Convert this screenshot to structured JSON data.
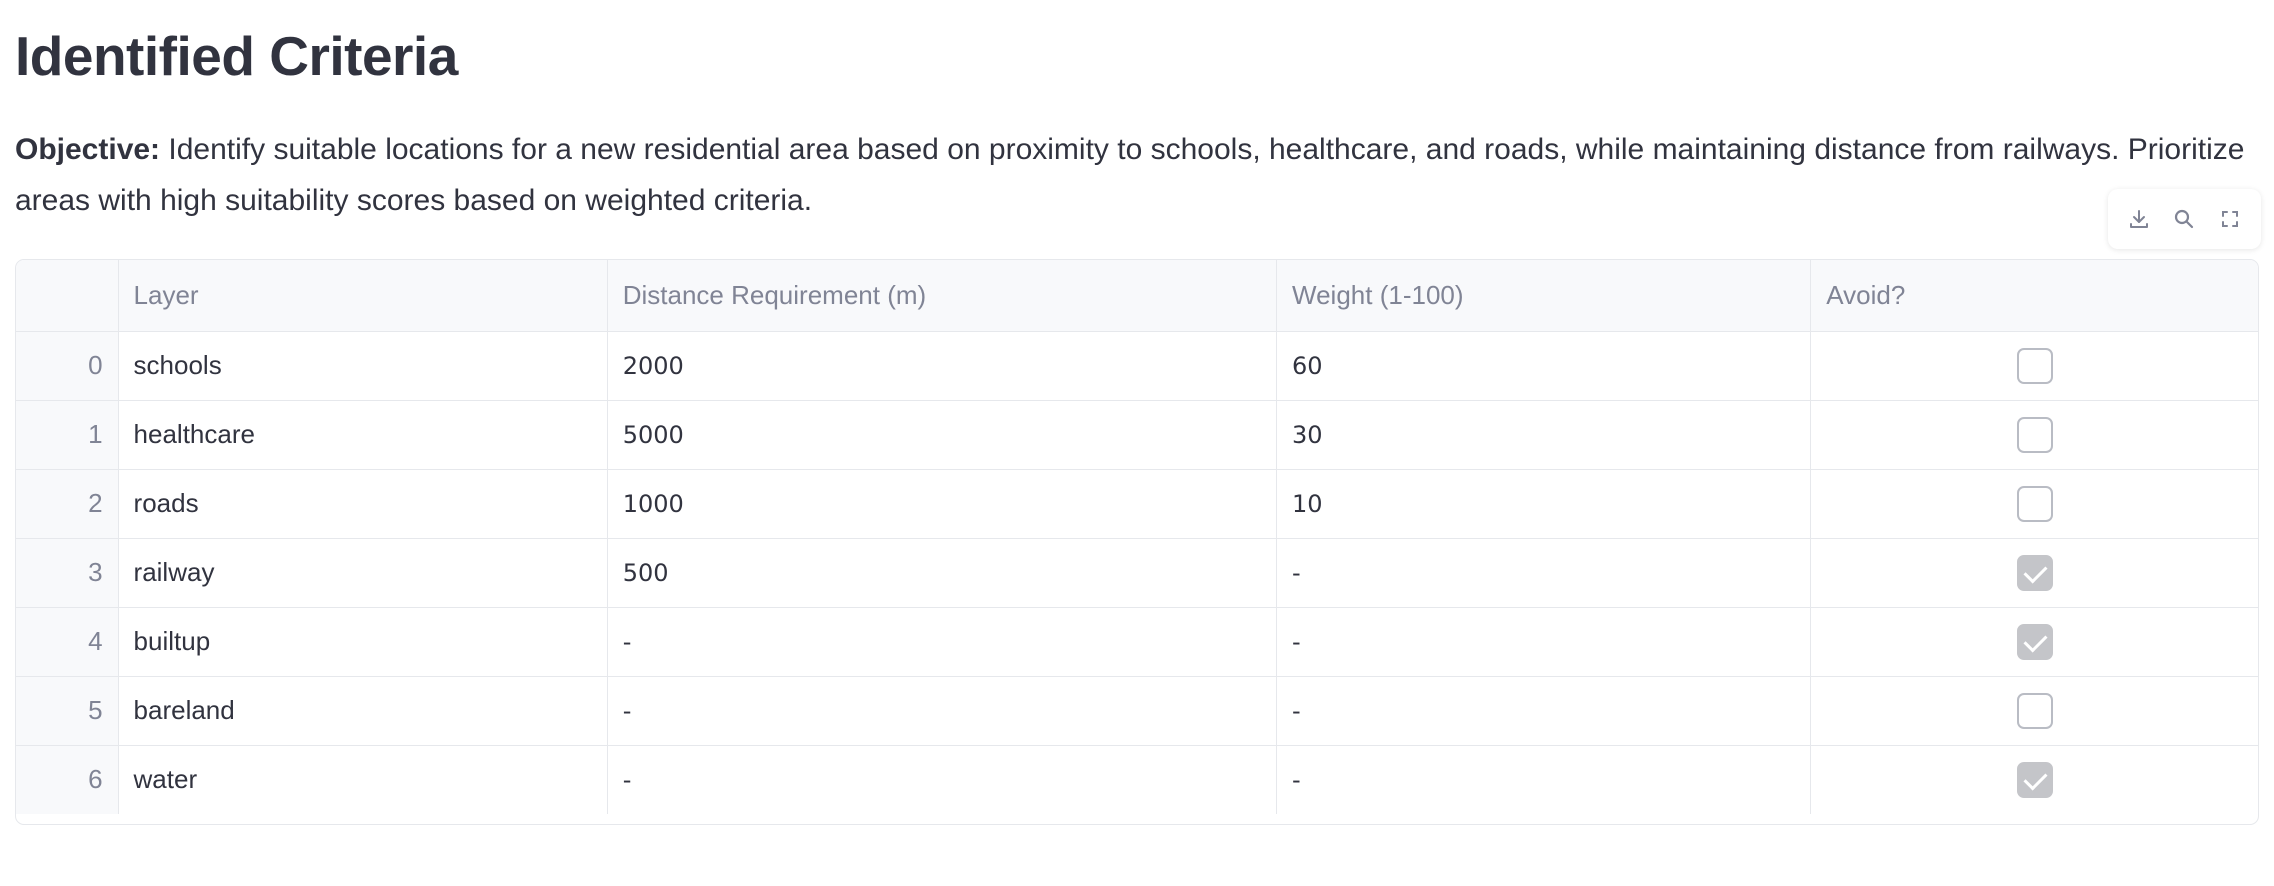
{
  "heading": "Identified Criteria",
  "objective": {
    "label": "Objective:",
    "text": " Identify suitable locations for a new residential area based on proximity to schools, healthcare, and roads, while maintaining distance from railways. Prioritize areas with high suitability scores based on weighted criteria."
  },
  "toolbar": {
    "icons": [
      "download-icon",
      "search-icon",
      "fullscreen-icon"
    ]
  },
  "table": {
    "columns": [
      "",
      "Layer",
      "Distance Requirement (m)",
      "Weight (1-100)",
      "Avoid?"
    ],
    "rows": [
      {
        "index": "0",
        "layer": "schools",
        "distance": "2000",
        "weight": "60",
        "avoid": false
      },
      {
        "index": "1",
        "layer": "healthcare",
        "distance": "5000",
        "weight": "30",
        "avoid": false
      },
      {
        "index": "2",
        "layer": "roads",
        "distance": "1000",
        "weight": "10",
        "avoid": false
      },
      {
        "index": "3",
        "layer": "railway",
        "distance": "500",
        "weight": "-",
        "avoid": true
      },
      {
        "index": "4",
        "layer": "builtup",
        "distance": "-",
        "weight": "-",
        "avoid": true
      },
      {
        "index": "5",
        "layer": "bareland",
        "distance": "-",
        "weight": "-",
        "avoid": false
      },
      {
        "index": "6",
        "layer": "water",
        "distance": "-",
        "weight": "-",
        "avoid": true
      }
    ]
  },
  "colors": {
    "text": "#31333f",
    "muted": "#808495",
    "border": "#e6e8ec",
    "header_bg": "#f8f9fb",
    "checked_fill": "#c4c5c9"
  }
}
